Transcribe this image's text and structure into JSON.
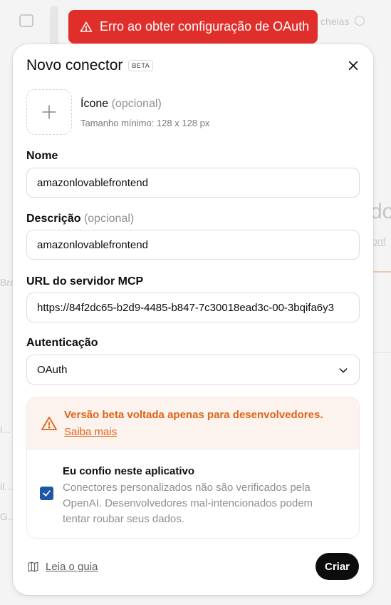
{
  "background": {
    "text_top_right": "cheias",
    "text_big_right": "do",
    "text_link_right": "onf",
    "text_left_1": "Bra",
    "text_left_2": "i...",
    "text_left_3": "il...",
    "text_left_4": "G..."
  },
  "toast": {
    "icon": "warning-triangle-icon",
    "message": "Erro ao obter configuração de OAuth",
    "color": "#e02e2a"
  },
  "modal": {
    "title": "Novo conector",
    "badge": "BETA",
    "icon_field": {
      "label": "Ícone",
      "optional": "(opcional)",
      "hint": "Tamanho mínimo: 128 x 128 px"
    },
    "name_field": {
      "label": "Nome",
      "value": "amazonlovablefrontend"
    },
    "description_field": {
      "label": "Descrição",
      "optional": "(opcional)",
      "value": "amazonlovablefrontend"
    },
    "url_field": {
      "label": "URL do servidor MCP",
      "value": "https://84f2dc65-b2d9-4485-b847-7c30018ead3c-00-3bqifa6y3"
    },
    "auth_field": {
      "label": "Autenticação",
      "selected": "OAuth"
    },
    "warning": {
      "title": "Versão beta voltada apenas para desenvolvedores.",
      "link": "Saiba mais",
      "color": "#e06417"
    },
    "trust": {
      "checked": true,
      "title": "Eu confio neste aplicativo",
      "description": "Conectores personalizados não são verificados pela OpenAI. Desenvolvedores mal-intencionados podem tentar roubar seus dados."
    },
    "footer": {
      "guide_label": "Leia o guia",
      "create_label": "Criar"
    }
  }
}
